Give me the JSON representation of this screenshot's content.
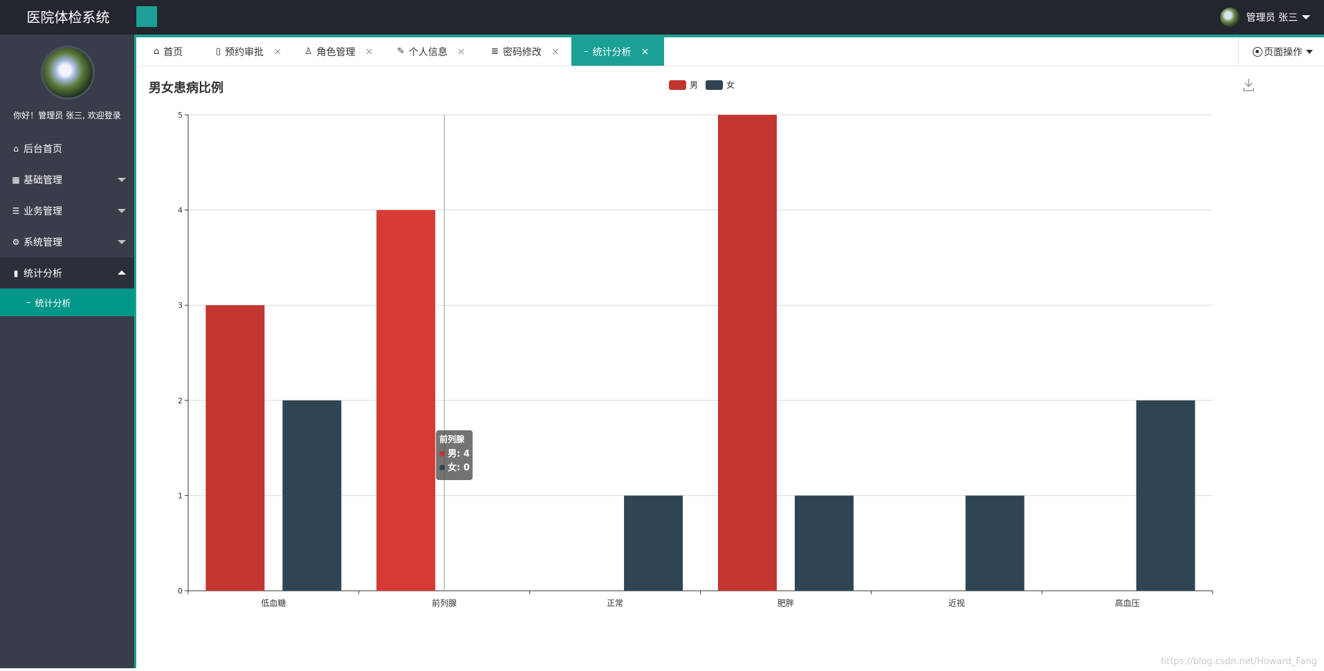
{
  "app": {
    "title": "医院体检系统",
    "user_label": "管理员 张三"
  },
  "sidebar": {
    "welcome": "你好！管理员 张三, 欢迎登录",
    "items": [
      {
        "label": "后台首页",
        "icon": "home-icon"
      },
      {
        "label": "基础管理",
        "icon": "grid-icon"
      },
      {
        "label": "业务管理",
        "icon": "list-icon"
      },
      {
        "label": "系统管理",
        "icon": "gear-icon"
      },
      {
        "label": "统计分析",
        "icon": "chat-icon"
      }
    ],
    "sub_item": "统计分析"
  },
  "tabs": [
    {
      "label": "首页",
      "icon": "home-icon",
      "closable": false
    },
    {
      "label": "预约审批",
      "icon": "phone-icon",
      "closable": true
    },
    {
      "label": "角色管理",
      "icon": "user-icon",
      "closable": true
    },
    {
      "label": "个人信息",
      "icon": "brush-icon",
      "closable": true
    },
    {
      "label": "密码修改",
      "icon": "align-icon",
      "closable": true
    },
    {
      "label": "统计分析",
      "icon": "minus-icon",
      "closable": true,
      "active": true
    }
  ],
  "page_ops": "页面操作",
  "chart_data": {
    "type": "bar",
    "title": "男女患病比例",
    "categories": [
      "低血糖",
      "前列腺",
      "正常",
      "肥胖",
      "近视",
      "高血压"
    ],
    "series": [
      {
        "name": "男",
        "color": "#c23531",
        "values": [
          3,
          4,
          0,
          5,
          0,
          0
        ]
      },
      {
        "name": "女",
        "color": "#2f4554",
        "values": [
          2,
          0,
          1,
          1,
          1,
          2
        ]
      }
    ],
    "ylim": [
      0,
      5
    ],
    "yticks": [
      0,
      1,
      2,
      3,
      4,
      5
    ],
    "grid": true,
    "legend": "top-center",
    "tooltip": {
      "category": "前列腺",
      "lines": [
        "男: 4",
        "女: 0"
      ]
    }
  },
  "watermark": "https://blog.csdn.net/Howard_Fang"
}
